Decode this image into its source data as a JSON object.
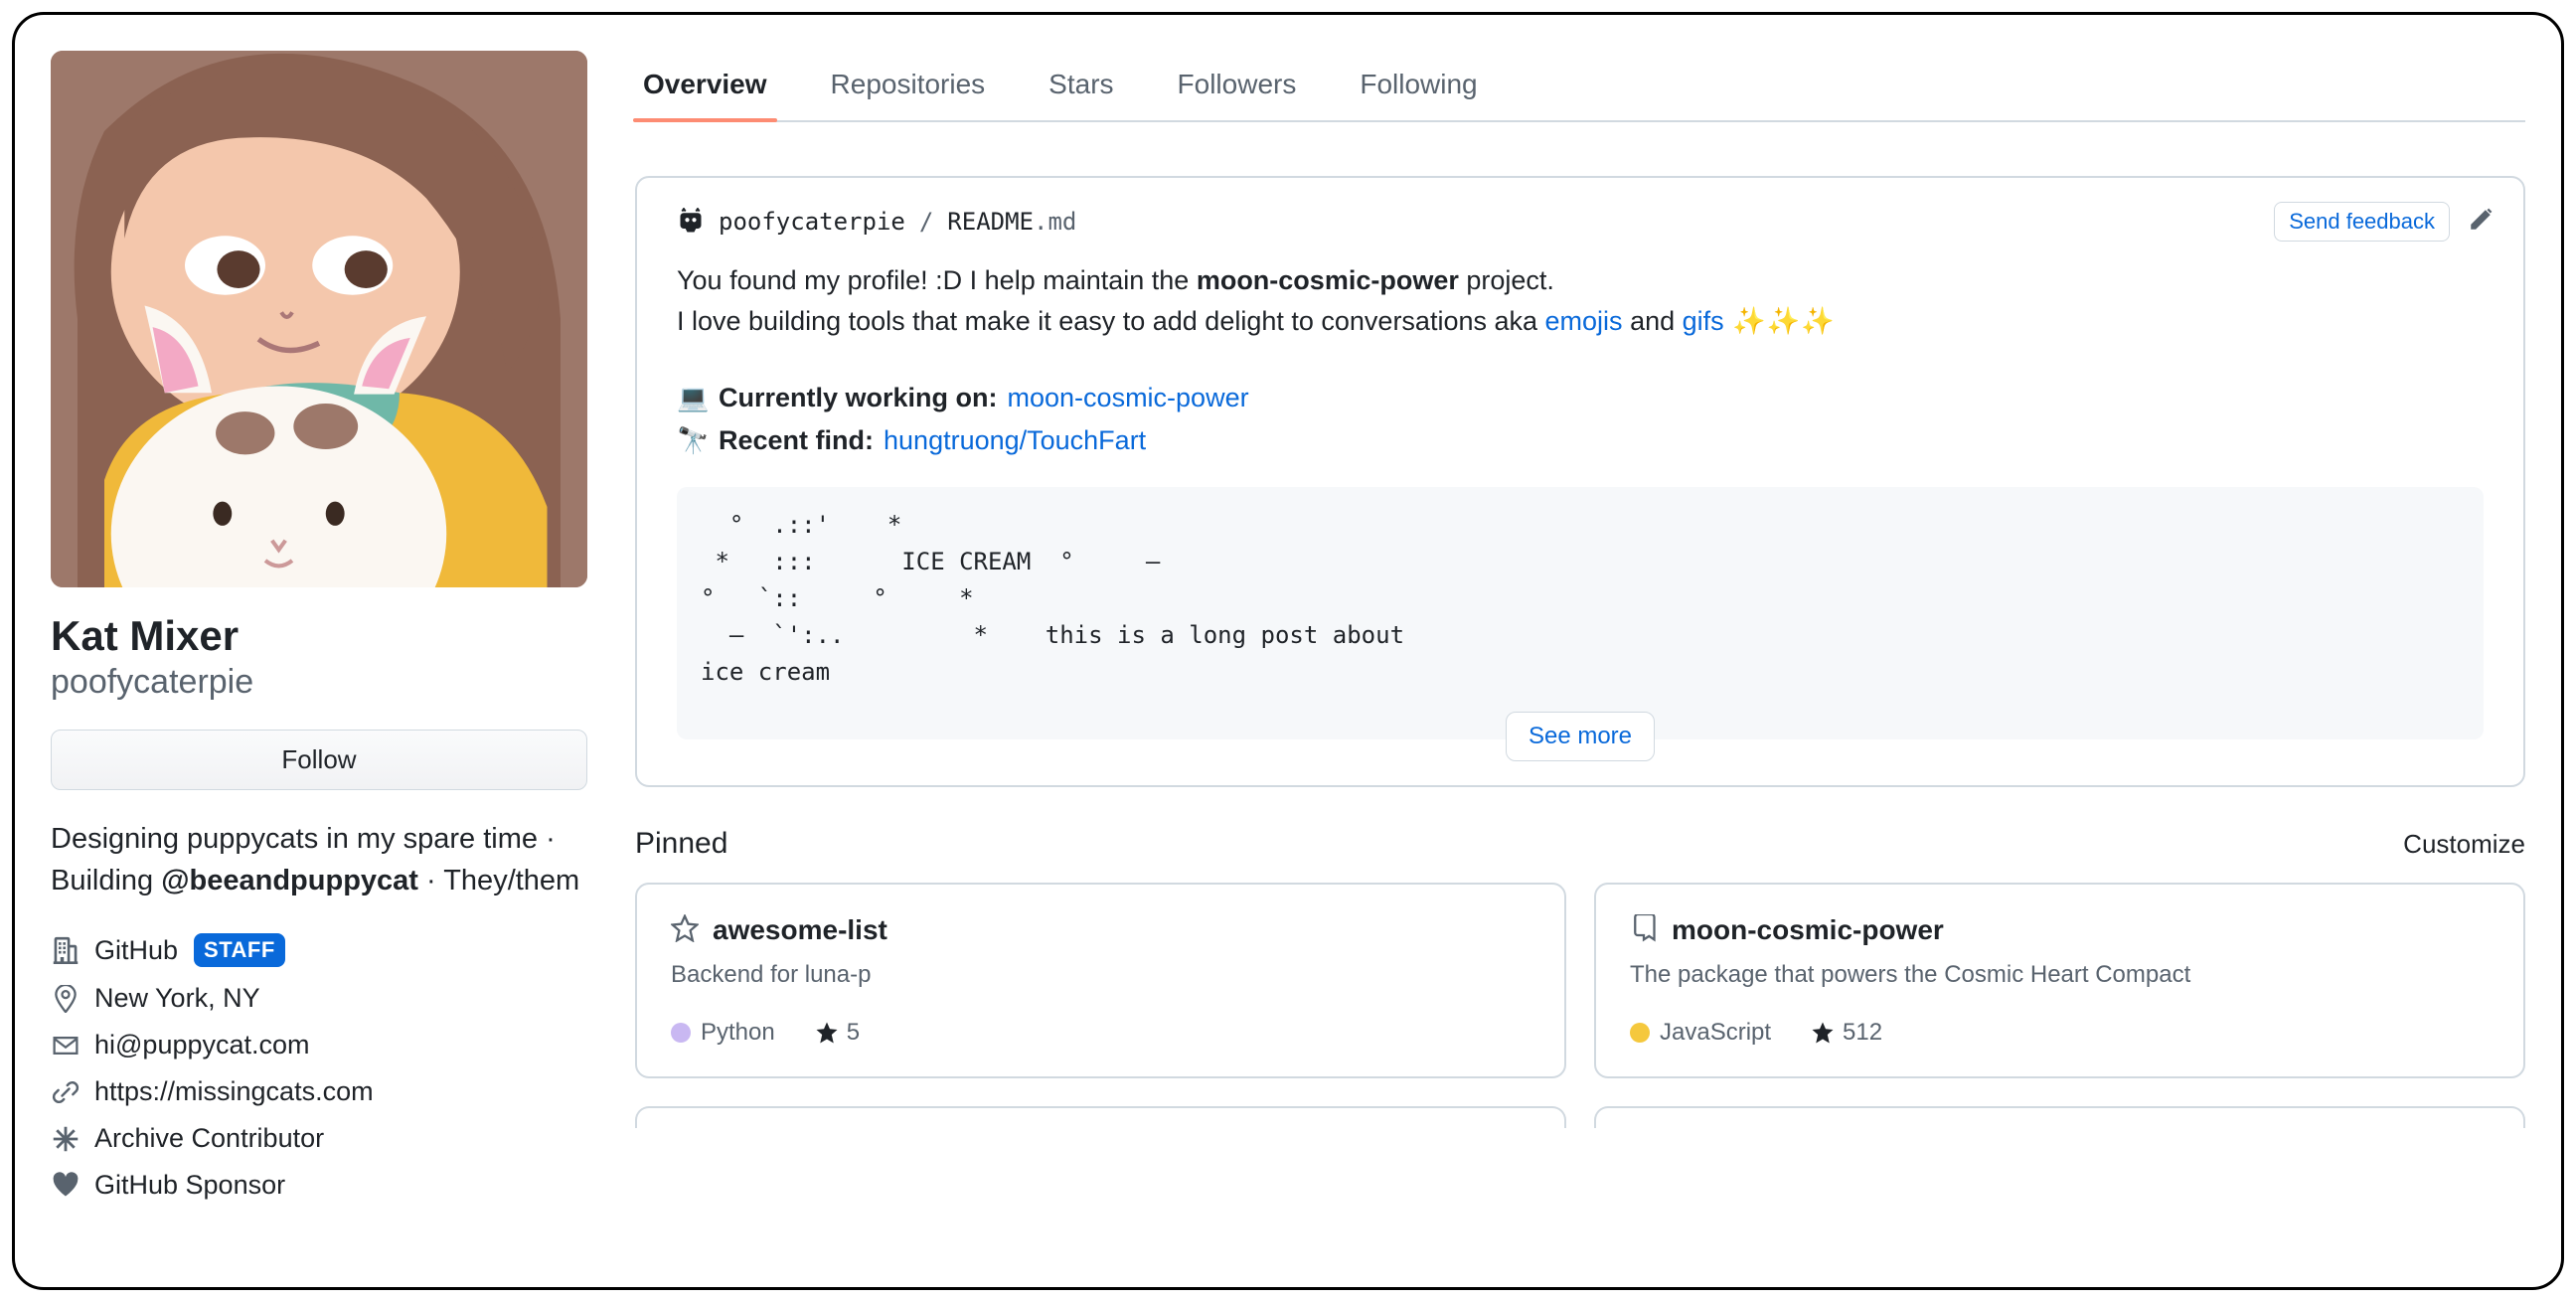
{
  "profile": {
    "fullname": "Kat Mixer",
    "username": "poofycaterpie",
    "follow_label": "Follow",
    "bio_pre": "Designing puppycats in my spare time · Building ",
    "bio_mention": "@beeandpuppycat",
    "bio_post": " · They/them",
    "meta": {
      "company": "GitHub",
      "staff_badge": "STAFF",
      "location": "New York, NY",
      "email": "hi@puppycat.com",
      "url": "https://missingcats.com",
      "achievement1": "Archive Contributor",
      "achievement2": "GitHub Sponsor"
    }
  },
  "tabs": [
    {
      "label": "Overview",
      "active": true
    },
    {
      "label": "Repositories",
      "active": false
    },
    {
      "label": "Stars",
      "active": false
    },
    {
      "label": "Followers",
      "active": false
    },
    {
      "label": "Following",
      "active": false
    }
  ],
  "readme": {
    "crumb_user": "poofycaterpie",
    "crumb_sep": "/",
    "crumb_file": "README",
    "crumb_ext": ".md",
    "feedback_label": "Send feedback",
    "line1_pre": "You found my profile! :D I help maintain the ",
    "line1_bold": "moon-cosmic-power",
    "line1_post": " project.",
    "line2_pre": "I love building tools that make it easy to add delight to conversations aka ",
    "line2_link1": "emojis",
    "line2_mid": " and ",
    "line2_link2": "gifs",
    "line2_sparkles": " ✨✨✨",
    "working_emoji": "💻",
    "working_label": "Currently working on: ",
    "working_link": "moon-cosmic-power",
    "find_emoji": "🔭",
    "find_label": "Recent find: ",
    "find_link": "hungtruong/TouchFart",
    "ascii": "  °  .::'    *\n *   :::      ICE CREAM  °     –\n°   `::     °     *\n  –  `':..         *    this is a long post about\nice cream",
    "see_more_label": "See more"
  },
  "pinned": {
    "heading": "Pinned",
    "customize_label": "Customize",
    "repos": [
      {
        "icon": "star",
        "name": "awesome-list",
        "description": "Backend for luna-p",
        "language": "Python",
        "lang_color": "#c9b8f2",
        "stars": "5"
      },
      {
        "icon": "repo",
        "name": "moon-cosmic-power",
        "description": "The package that powers the Cosmic Heart Compact",
        "language": "JavaScript",
        "lang_color": "#f5c83d",
        "stars": "512"
      }
    ]
  }
}
